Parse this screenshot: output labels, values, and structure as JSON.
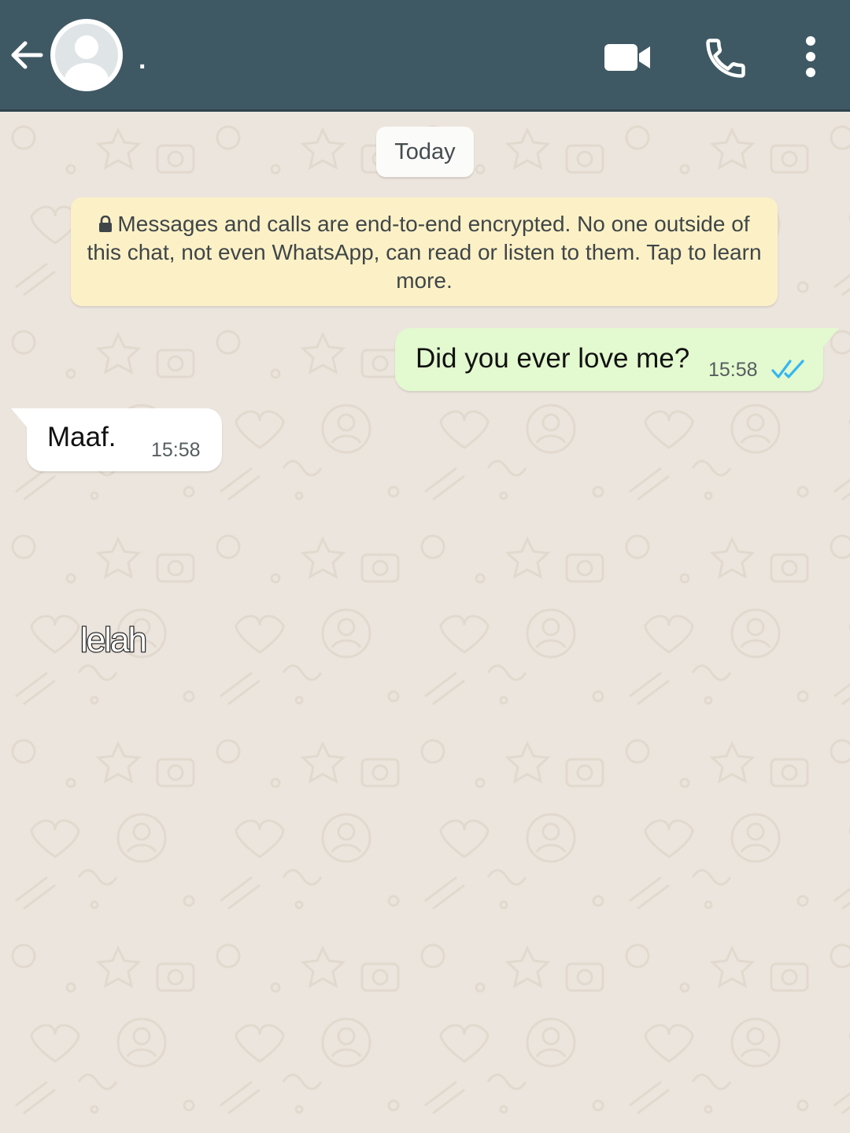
{
  "header": {
    "back_icon": "arrow-left-icon",
    "avatar_icon": "default-avatar-icon",
    "contact_name": ".",
    "video_icon": "video-call-icon",
    "call_icon": "phone-icon",
    "menu_icon": "more-vert-icon",
    "background_color": "#3f5964"
  },
  "chat": {
    "date_chip": "Today",
    "encryption_notice": {
      "icon": "lock-icon",
      "text": "Messages and calls are end-to-end encrypted. No one outside of this chat, not even WhatsApp, can read or listen to them. Tap to learn more."
    },
    "messages": [
      {
        "direction": "outgoing",
        "text": "Did you ever love me?",
        "time": "15:58",
        "status_icon": "double-check-read-icon",
        "status_color": "#34b7f1"
      },
      {
        "direction": "incoming",
        "text": "Maaf.",
        "time": "15:58"
      }
    ],
    "overlay_caption": "lelah"
  }
}
